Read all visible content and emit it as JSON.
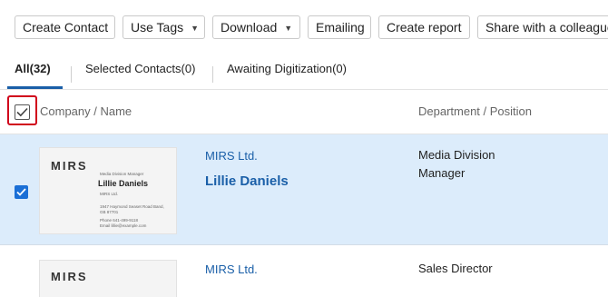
{
  "toolbar": {
    "create_contact": "Create Contact",
    "use_tags": "Use Tags",
    "download": "Download",
    "emailing": "Emailing",
    "create_report": "Create report",
    "share": "Share with a colleague"
  },
  "tabs": [
    {
      "label": "All(32)",
      "active": true
    },
    {
      "label": "Selected Contacts(0)",
      "active": false
    },
    {
      "label": "Awaiting Digitization(0)",
      "active": false
    }
  ],
  "table": {
    "header_company": "Company / Name",
    "header_department": "Department / Position",
    "select_all_checked": true,
    "rows": [
      {
        "checked": true,
        "company": "MIRS Ltd.",
        "name": "Lillie Daniels",
        "department": "Media Division",
        "position": "Manager",
        "card": {
          "brand": "MIRS",
          "title": "Media Division Manager",
          "name": "Lillie Daniels",
          "company": "MIRS Ltd.",
          "address_1": "1947 Haymond Seaset Road Band,",
          "address_2": "GB 87701",
          "phone": "Phone 641-499-9118",
          "email": "Email lillie@example.com"
        }
      },
      {
        "checked": false,
        "company": "MIRS Ltd.",
        "name": "",
        "department": "Sales Director",
        "position": "",
        "card": {
          "brand": "MIRS"
        }
      }
    ]
  },
  "colors": {
    "accent": "#1a5fa8",
    "selected_row": "#dcecfb",
    "highlight_frame": "#d0021b",
    "checkbox_blue": "#1a6fd6"
  }
}
